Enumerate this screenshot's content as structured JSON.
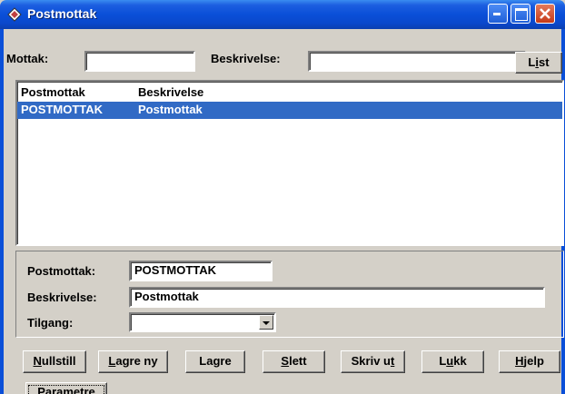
{
  "window": {
    "title": "Postmottak"
  },
  "filter": {
    "mottak_label": "Mottak:",
    "mottak_value": "",
    "beskrivelse_label": "Beskrivelse:",
    "beskrivelse_value": "",
    "list_button": {
      "pre": "L",
      "u": "i",
      "post": "st"
    }
  },
  "list": {
    "columns": [
      "Postmottak",
      "Beskrivelse"
    ],
    "rows": [
      {
        "postmottak": "POSTMOTTAK",
        "beskrivelse": "Postmottak",
        "selected": true
      }
    ]
  },
  "detail": {
    "postmottak_label": "Postmottak:",
    "postmottak_value": "POSTMOTTAK",
    "beskrivelse_label": "Beskrivelse:",
    "beskrivelse_value": "Postmottak",
    "tilgang_label": "Tilgang:",
    "tilgang_value": ""
  },
  "buttons": {
    "nullstill": {
      "pre": "",
      "u": "N",
      "post": "ullstill"
    },
    "lagre_ny": {
      "pre": "",
      "u": "L",
      "post": "agre ny"
    },
    "lagre": {
      "pre": "La",
      "u": "g",
      "post": "re"
    },
    "slett": {
      "pre": "",
      "u": "S",
      "post": "lett"
    },
    "skriv_ut": {
      "pre": "Skriv u",
      "u": "t",
      "post": ""
    },
    "lukk": {
      "pre": "L",
      "u": "u",
      "post": "kk"
    },
    "hjelp": {
      "pre": "",
      "u": "H",
      "post": "jelp"
    },
    "parametre": "Parametre"
  },
  "colors": {
    "titlebar": "#0A4FD8",
    "selection": "#316AC5",
    "face": "#D4D0C8"
  }
}
